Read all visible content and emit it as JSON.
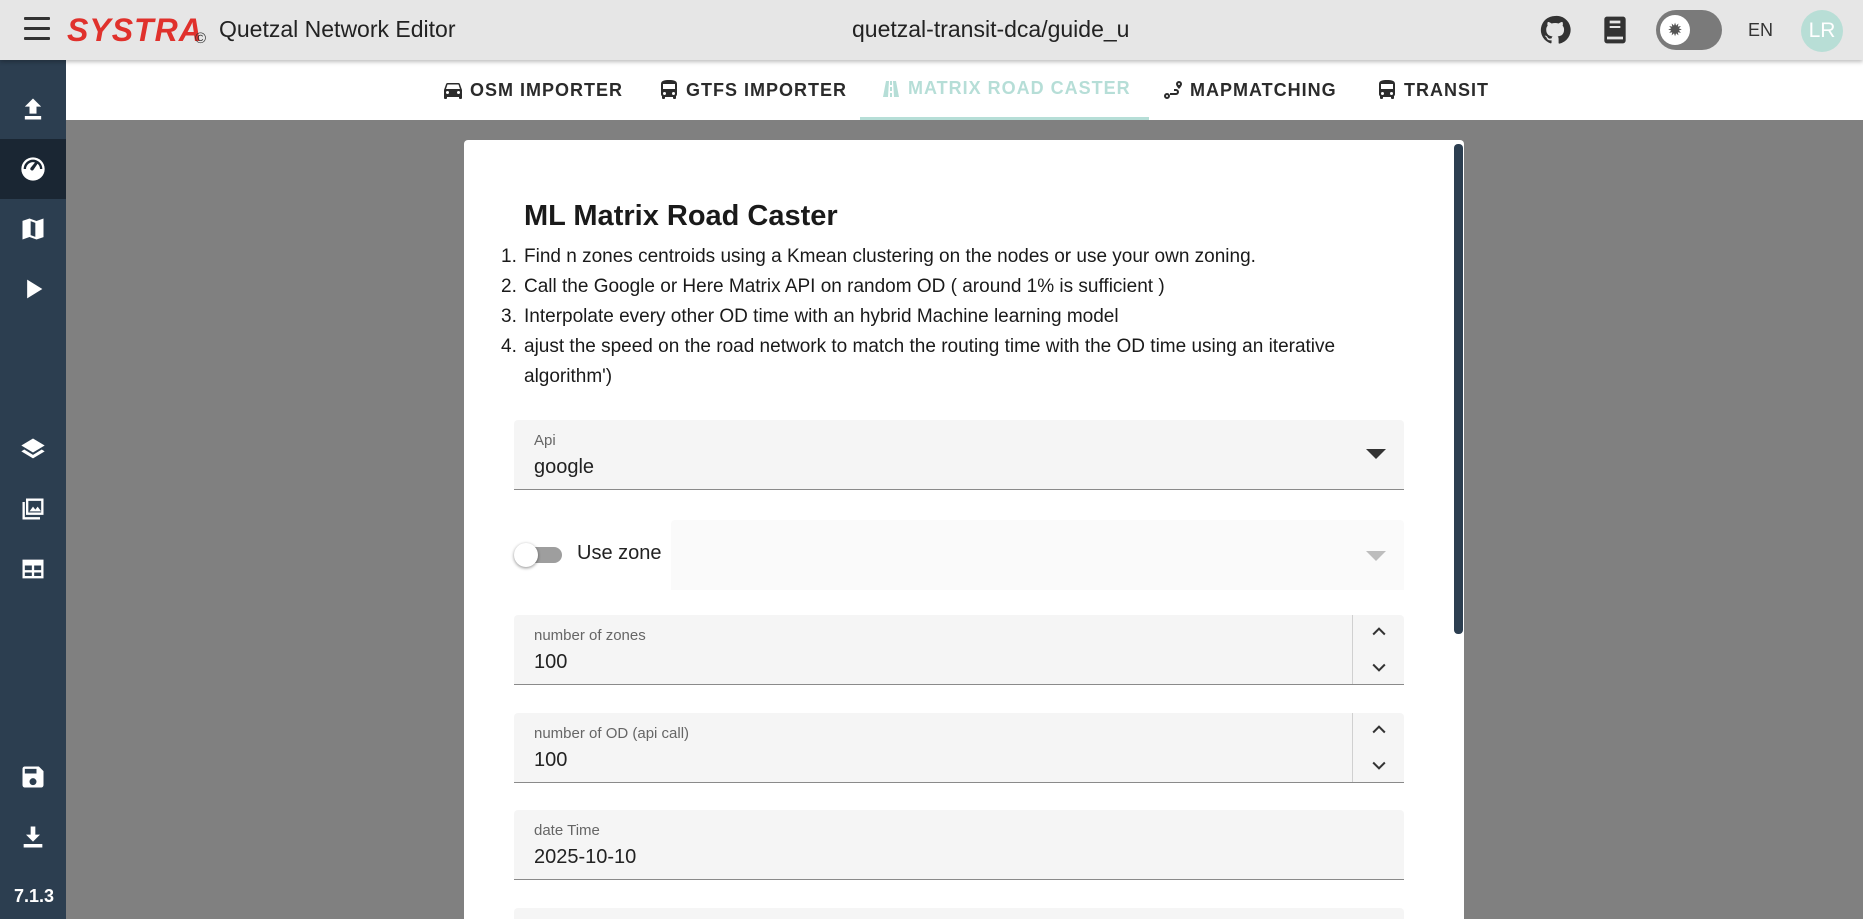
{
  "header": {
    "brand": "SYSTRA",
    "copyright": "©",
    "app_title": "Quetzal Network Editor",
    "project": "quetzal-transit-dca/guide_u",
    "language": "EN",
    "user_initials": "LR",
    "icons": [
      "menu-icon",
      "github-icon",
      "book-icon",
      "brightness-icon"
    ]
  },
  "sidebar": {
    "items": [
      {
        "name": "upload",
        "icon": "upload-icon"
      },
      {
        "name": "dashboard",
        "icon": "speedometer-icon",
        "active": true
      },
      {
        "name": "map",
        "icon": "map-icon"
      },
      {
        "name": "run",
        "icon": "play-icon"
      },
      {
        "name": "layers",
        "icon": "layers-icon"
      },
      {
        "name": "gallery",
        "icon": "image-multiple-icon"
      },
      {
        "name": "table",
        "icon": "table-icon"
      },
      {
        "name": "save",
        "icon": "save-icon"
      },
      {
        "name": "download",
        "icon": "download-icon"
      }
    ],
    "version": "7.1.3"
  },
  "tabs": [
    {
      "label": "OSM IMPORTER",
      "icon": "car-icon"
    },
    {
      "label": "GTFS IMPORTER",
      "icon": "bus-icon"
    },
    {
      "label": "MATRIX ROAD CASTER",
      "icon": "road-icon",
      "active": true
    },
    {
      "label": "MAPMATCHING",
      "icon": "route-icon"
    },
    {
      "label": "TRANSIT",
      "icon": "bus-icon"
    }
  ],
  "main": {
    "title": "ML Matrix Road Caster",
    "steps": [
      {
        "num": "1.",
        "text": "Find n zones centroids using a Kmean clustering on the nodes or use your own zoning."
      },
      {
        "num": "2.",
        "text": "Call the Google or Here Matrix API on random OD ( around 1% is sufficient )"
      },
      {
        "num": "3.",
        "text": "Interpolate every other OD time with an hybrid Machine learning model"
      },
      {
        "num": "4.",
        "text": "ajust the speed on the road network to match the routing time with the OD time using an iterative algorithm')"
      }
    ],
    "api": {
      "label": "Api",
      "value": "google"
    },
    "use_zone": {
      "label": "Use zone",
      "checked": false
    },
    "num_zones": {
      "label": "number of zones",
      "value": "100"
    },
    "num_od": {
      "label": "number of OD (api call)",
      "value": "100"
    },
    "date_time": {
      "label": "date Time",
      "value": "2025-10-10"
    }
  },
  "colors": {
    "topbar": "#e6e6e6",
    "rail": "#2c3e50",
    "brand_red": "#e0312c",
    "active_tab": "#b6ded7",
    "backdrop": "#808080"
  }
}
